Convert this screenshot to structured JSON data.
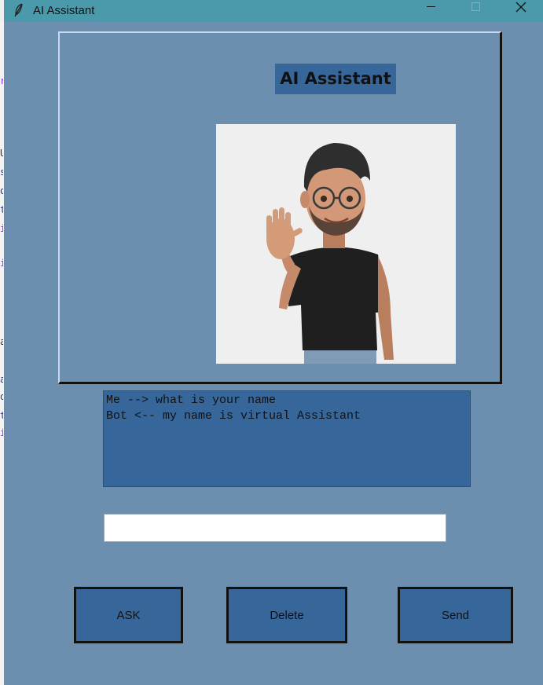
{
  "window": {
    "title": "AI Assistant"
  },
  "app": {
    "heading": "AI Assistant",
    "chat_lines": [
      "Me --> what is your name",
      "Bot <-- my name is virtual Assistant"
    ],
    "input_value": "",
    "buttons": {
      "ask": "ASK",
      "delete": "Delete",
      "send": "Send"
    }
  },
  "icons": {
    "title": "feather-icon",
    "minimize": "minimize-icon",
    "maximize": "maximize-icon",
    "close": "close-icon",
    "avatar": "avatar-waving-image"
  },
  "colors": {
    "titlebar": "#4a9aac",
    "window_bg": "#6d8faf",
    "panel": "#36669a",
    "border_dark": "#111111"
  }
}
